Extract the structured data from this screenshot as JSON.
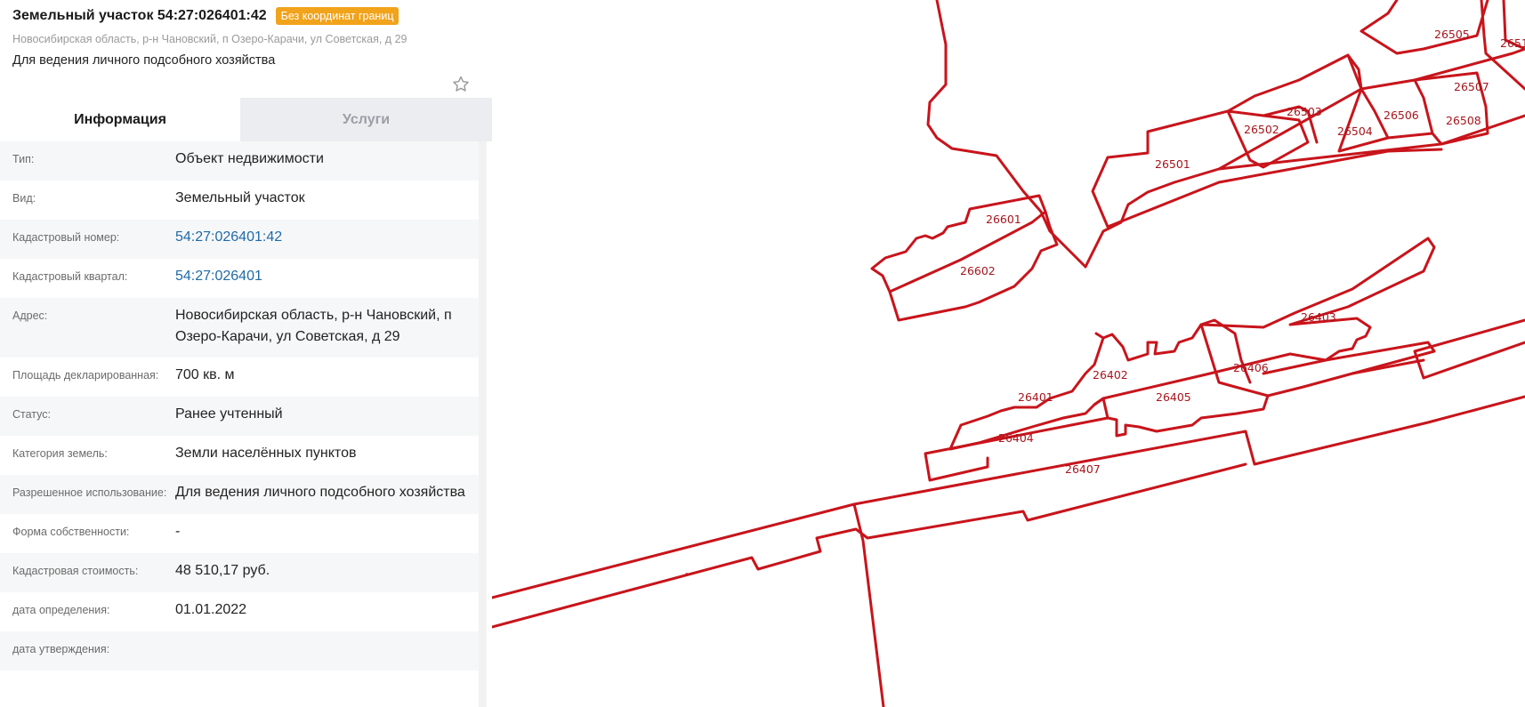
{
  "parcel": {
    "title": "Земельный участок 54:27:026401:42",
    "badge": "Без координат границ",
    "address_short": "Новосибирская область, р-н Чановский, п Озеро-Карачи, ул Советская, д 29",
    "purpose": "Для ведения личного подсобного хозяйства",
    "favorite_icon": "star-outline-icon"
  },
  "tabs": [
    {
      "label": "Информация",
      "active": true
    },
    {
      "label": "Услуги",
      "active": false
    }
  ],
  "info_rows": [
    {
      "label": "Тип:",
      "value": "Объект недвижимости"
    },
    {
      "label": "Вид:",
      "value": "Земельный участок"
    },
    {
      "label": "Кадастровый номер:",
      "value": "54:27:026401:42"
    },
    {
      "label": "Кадастровый квартал:",
      "value": "54:27:026401"
    },
    {
      "label": "Адрес:",
      "value": "Новосибирская область, р-н Чановский, п Озеро-Карачи, ул Советская, д 29"
    },
    {
      "label": "Площадь декларированная:",
      "value": "700 кв. м"
    },
    {
      "label": "Статус:",
      "value": "Ранее учтенный"
    },
    {
      "label": "Категория земель:",
      "value": "Земли населённых пунктов"
    },
    {
      "label": "Разрешенное использование:",
      "value": "Для ведения личного подсобного хозяйства"
    },
    {
      "label": "Форма собственности:",
      "value": "-"
    },
    {
      "label": "Кадастровая стоимость:",
      "value": "48 510,17 руб."
    },
    {
      "label": "дата определения:",
      "value": "01.01.2022"
    },
    {
      "label": "дата утверждения:",
      "value": ""
    }
  ],
  "map": {
    "boundary_color": "#c8141b",
    "label_color": "#a8151c",
    "parcel_labels": [
      "26505",
      "2651",
      "26507",
      "26503",
      "26502",
      "26504",
      "26506",
      "26508",
      "26501",
      "26601",
      "26602",
      "26403",
      "26406",
      "26402",
      "26401",
      "26405",
      "26404",
      "26407"
    ]
  }
}
